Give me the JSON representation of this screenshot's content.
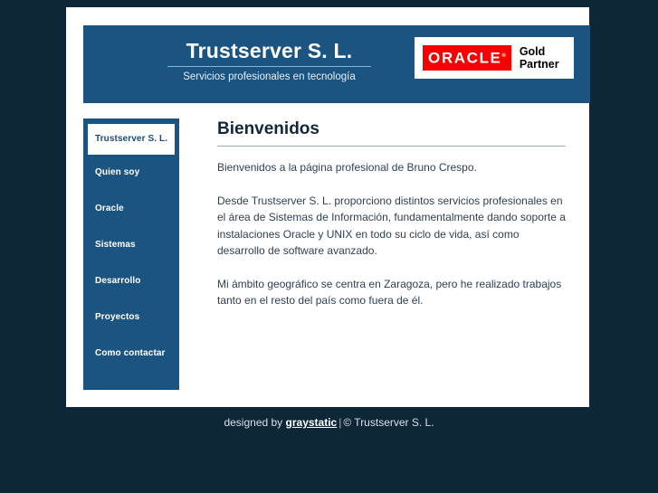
{
  "header": {
    "brand_title": "Trustserver S. L.",
    "brand_subtitle": "Servicios profesionales en tecnología",
    "oracle_badge": {
      "mark_text": "ORACLE",
      "registered_mark": "®",
      "partner_line1": "Gold",
      "partner_line2": "Partner"
    }
  },
  "sidebar": {
    "items": [
      {
        "label": "Trustserver S. L.",
        "active": true
      },
      {
        "label": "Quien soy",
        "active": false
      },
      {
        "label": "Oracle",
        "active": false
      },
      {
        "label": "Sistemas",
        "active": false
      },
      {
        "label": "Desarrollo",
        "active": false
      },
      {
        "label": "Proyectos",
        "active": false
      },
      {
        "label": "Como contactar",
        "active": false
      }
    ]
  },
  "main": {
    "title": "Bienvenidos",
    "paragraphs": [
      "Bienvenidos a la página profesional de Bruno Crespo.",
      "Desde Trustserver S. L. proporciono distintos servicios profesionales en el área de Sistemas de Información, fundamentalmente dando soporte a instalaciones Oracle y UNIX en todo su ciclo de vida, así como desarrollo de software avanzado.",
      "Mi ámbito geográfico se centra en Zaragoza, pero he realizado trabajos tanto en el resto del país como fuera de él."
    ]
  },
  "footer": {
    "designed_by": "designed by ",
    "designer_name": "graystatic",
    "separator": "|",
    "copyright": "© Trustserver S. L."
  },
  "colors": {
    "page_background": "#0d2739",
    "panel_blue": "#1b5480",
    "container_white": "#ffffff",
    "rule_blue": "#8fb2cc",
    "oracle_red": "#f80000",
    "body_text": "#2d3f52",
    "heading": "#12273d"
  }
}
